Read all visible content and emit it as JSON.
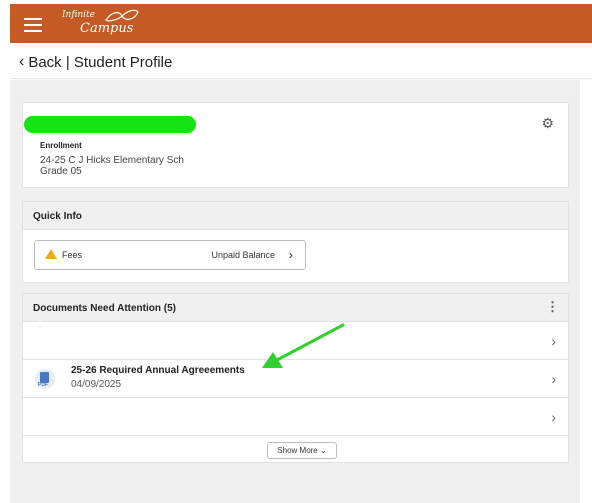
{
  "app": {
    "logo_top": "Infinite",
    "logo_bottom": "Campus",
    "brand_color": "#c55a24"
  },
  "nav": {
    "back_label": "Back | Student Profile"
  },
  "profile": {
    "enrollment_label": "Enrollment",
    "school": "24-25 C J Hicks Elementary Sch",
    "grade": "Grade 05"
  },
  "quick_info": {
    "title": "Quick Info",
    "fees_label": "Fees",
    "fees_status": "Unpaid Balance"
  },
  "documents": {
    "title": "Documents Need Attention (5)",
    "faint_text": "- ",
    "items": [
      {
        "title": "",
        "date": ""
      },
      {
        "title": "25-26 Required Annual Agreeements",
        "date": "04/09/2025",
        "icon_label": "PDF"
      },
      {
        "title": "",
        "date": ""
      }
    ],
    "show_more": "Show More"
  },
  "annotation": {
    "arrow_color": "#2fd12f"
  }
}
